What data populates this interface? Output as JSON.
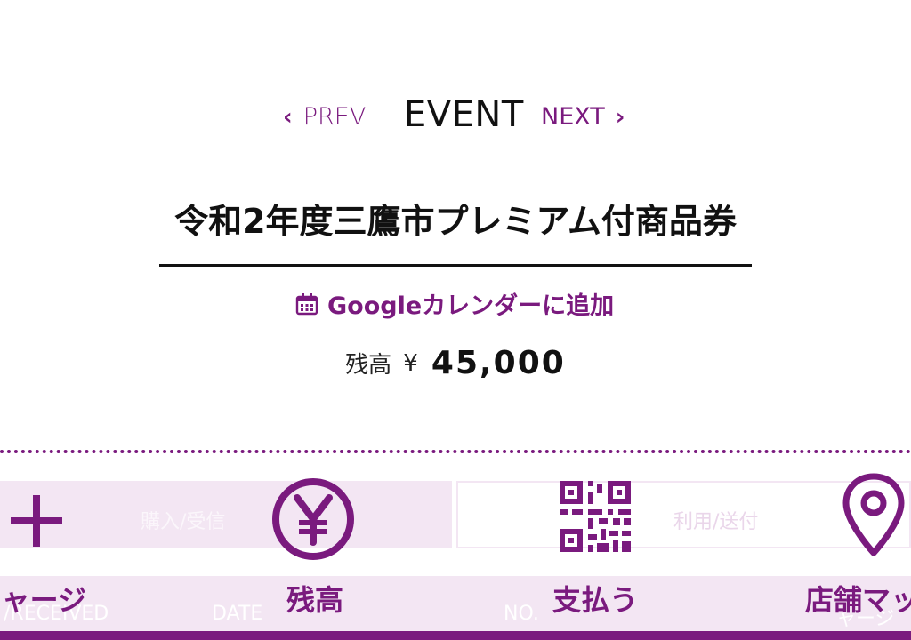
{
  "nav": {
    "prev_label": "PREV",
    "title": "EVENT",
    "next_label": "NEXT"
  },
  "event": {
    "title": "令和2年度三鷹市プレミアム付商品券"
  },
  "calendar": {
    "label": "Googleカレンダーに追加"
  },
  "balance": {
    "label": "残高",
    "currency": "¥",
    "amount": "45,000"
  },
  "tabs": {
    "left_ghost": "購入/受信",
    "right_ghost": "利用/送付"
  },
  "columns": {
    "col1": "/RECEIVED",
    "col2": "DATE",
    "col3": "NO.",
    "col4": "ャージ"
  },
  "toolbar": {
    "charge_label": "チャージ",
    "balance_label": "残高",
    "pay_label": "支払う",
    "map_label": "店舗マップ"
  },
  "colors": {
    "accent": "#7a1a7e",
    "light_accent": "#f3e6f3"
  }
}
